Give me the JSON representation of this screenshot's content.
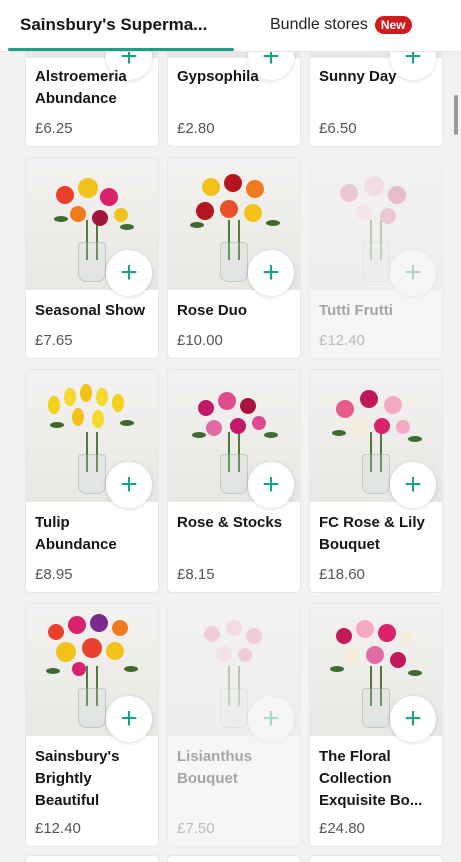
{
  "tabs": {
    "store": "Sainsbury's Superma...",
    "bundle": "Bundle stores",
    "bundle_badge": "New"
  },
  "products": [
    {
      "name": "Alstroemeria Abundance",
      "price": "£6.25"
    },
    {
      "name": "Gypsophila",
      "price": "£2.80"
    },
    {
      "name": "Sunny Day",
      "price": "£6.50"
    },
    {
      "name": "Seasonal Show",
      "price": "£7.65"
    },
    {
      "name": "Rose Duo",
      "price": "£10.00"
    },
    {
      "name": "Tutti Frutti",
      "price": "£12.40"
    },
    {
      "name": "Tulip Abundance",
      "price": "£8.95"
    },
    {
      "name": "Rose & Stocks",
      "price": "£8.15"
    },
    {
      "name": "FC Rose & Lily Bouquet",
      "price": "£18.60"
    },
    {
      "name": "Sainsbury's Brightly Beautiful",
      "price": "£12.40"
    },
    {
      "name": "Lisianthus Bouquet",
      "price": "£7.50"
    },
    {
      "name": "The Floral Collection Exquisite Bo...",
      "price": "£24.80"
    }
  ],
  "add_label": "+",
  "colors": {
    "accent": "#1f9e8a",
    "badge": "#d01c1f"
  }
}
